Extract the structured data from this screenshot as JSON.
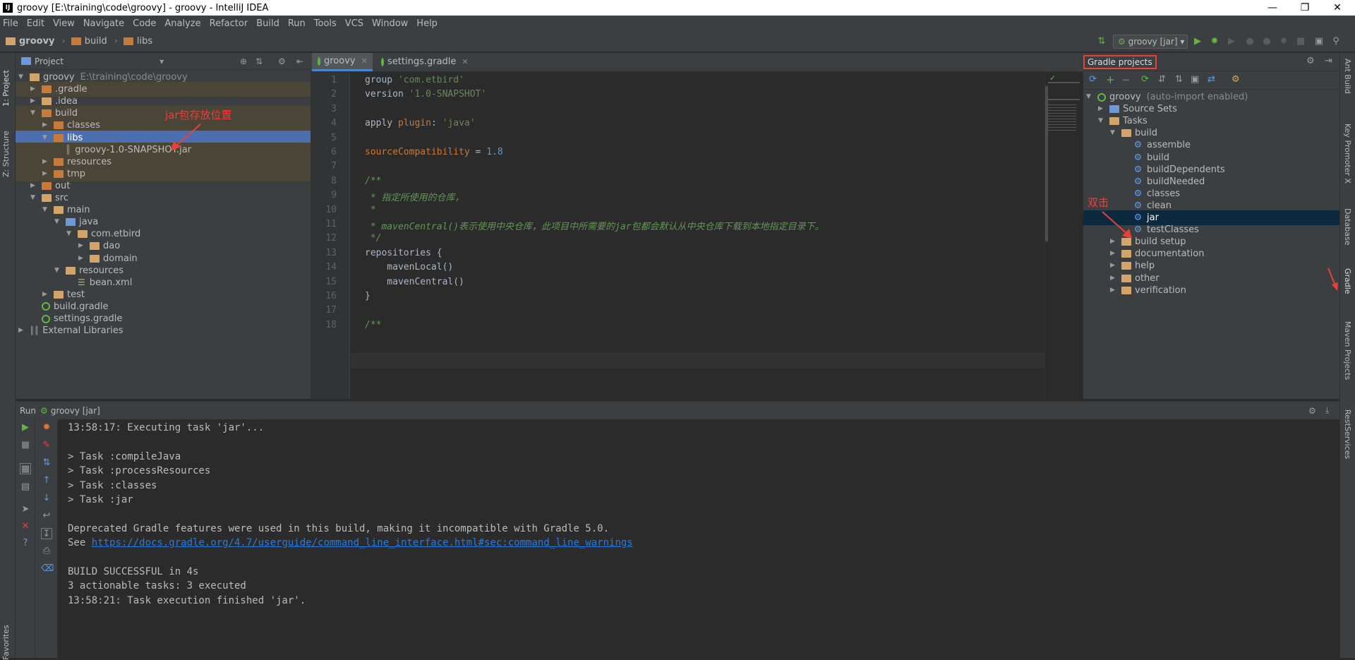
{
  "window": {
    "title": "groovy [E:\\training\\code\\groovy] - groovy - IntelliJ IDEA",
    "app_icon": "IJ"
  },
  "menu": [
    "File",
    "Edit",
    "View",
    "Navigate",
    "Code",
    "Analyze",
    "Refactor",
    "Build",
    "Run",
    "Tools",
    "VCS",
    "Window",
    "Help"
  ],
  "breadcrumb": [
    "groovy",
    "build",
    "libs"
  ],
  "run_config": "groovy [jar]",
  "left_tabs": [
    "1: Project",
    "Z: Structure",
    "Favorites"
  ],
  "project_panel": {
    "title": "Project",
    "tree": [
      {
        "label": "groovy",
        "extra": "E:\\training\\code\\groovy",
        "depth": 0,
        "expanded": true,
        "icon": "folder"
      },
      {
        "label": ".gradle",
        "depth": 1,
        "expanded": false,
        "icon": "folder-orange",
        "excluded": true
      },
      {
        "label": ".idea",
        "depth": 1,
        "expanded": false,
        "icon": "folder"
      },
      {
        "label": "build",
        "depth": 1,
        "expanded": true,
        "icon": "folder-orange",
        "excluded": true
      },
      {
        "label": "classes",
        "depth": 2,
        "expanded": false,
        "icon": "folder-orange",
        "excluded": true
      },
      {
        "label": "libs",
        "depth": 2,
        "expanded": true,
        "icon": "folder-orange",
        "selected": true
      },
      {
        "label": "groovy-1.0-SNAPSHOT.jar",
        "depth": 3,
        "leaf": true,
        "icon": "jar",
        "excluded": true
      },
      {
        "label": "resources",
        "depth": 2,
        "expanded": false,
        "icon": "folder-orange",
        "excluded": true
      },
      {
        "label": "tmp",
        "depth": 2,
        "expanded": false,
        "icon": "folder-orange",
        "excluded": true
      },
      {
        "label": "out",
        "depth": 1,
        "expanded": false,
        "icon": "folder-orange"
      },
      {
        "label": "src",
        "depth": 1,
        "expanded": true,
        "icon": "folder"
      },
      {
        "label": "main",
        "depth": 2,
        "expanded": true,
        "icon": "folder"
      },
      {
        "label": "java",
        "depth": 3,
        "expanded": true,
        "icon": "folder-blue"
      },
      {
        "label": "com.etbird",
        "depth": 4,
        "expanded": true,
        "icon": "folder"
      },
      {
        "label": "dao",
        "depth": 5,
        "expanded": false,
        "icon": "folder"
      },
      {
        "label": "domain",
        "depth": 5,
        "expanded": false,
        "icon": "folder"
      },
      {
        "label": "resources",
        "depth": 3,
        "expanded": true,
        "icon": "folder"
      },
      {
        "label": "bean.xml",
        "depth": 4,
        "leaf": true,
        "icon": "xml"
      },
      {
        "label": "test",
        "depth": 2,
        "expanded": false,
        "icon": "folder"
      },
      {
        "label": "build.gradle",
        "depth": 1,
        "leaf": true,
        "icon": "gradle"
      },
      {
        "label": "settings.gradle",
        "depth": 1,
        "leaf": true,
        "icon": "gradle"
      },
      {
        "label": "External Libraries",
        "depth": 0,
        "expanded": false,
        "icon": "lib"
      }
    ],
    "annotation": "jar包存放位置"
  },
  "editor": {
    "tabs": [
      {
        "label": "groovy",
        "active": true
      },
      {
        "label": "settings.gradle",
        "active": false
      }
    ],
    "line_numbers": [
      "1",
      "2",
      "3",
      "4",
      "5",
      "6",
      "7",
      "8",
      "9",
      "10",
      "11",
      "12",
      "13",
      "14",
      "15",
      "16",
      "17",
      "18"
    ],
    "lines": [
      [
        {
          "t": "group ",
          "c": "plain"
        },
        {
          "t": "'com.etbird'",
          "c": "str"
        }
      ],
      [
        {
          "t": "version ",
          "c": "plain"
        },
        {
          "t": "'1.0-SNAPSHOT'",
          "c": "str"
        }
      ],
      [],
      [
        {
          "t": "apply ",
          "c": "plain"
        },
        {
          "t": "plugin",
          "c": "kw"
        },
        {
          "t": ": ",
          "c": "plain"
        },
        {
          "t": "'java'",
          "c": "str"
        }
      ],
      [],
      [
        {
          "t": "sourceCompatibility",
          "c": "kw"
        },
        {
          "t": " = ",
          "c": "plain"
        },
        {
          "t": "1.8",
          "c": "num"
        }
      ],
      [],
      [
        {
          "t": "/**",
          "c": "cmt"
        }
      ],
      [
        {
          "t": " * 指定所使用的仓库，",
          "c": "cmt"
        }
      ],
      [
        {
          "t": " *",
          "c": "cmt"
        }
      ],
      [
        {
          "t": " * mavenCentral()表示使用中央仓库，此项目中所需要的jar包都会默认从中央仓库下载到本地指定目录下。",
          "c": "cmt"
        }
      ],
      [
        {
          "t": " */",
          "c": "cmt"
        }
      ],
      [
        {
          "t": "repositories {",
          "c": "plain"
        }
      ],
      [
        {
          "t": "    mavenLocal()",
          "c": "plain"
        }
      ],
      [
        {
          "t": "    mavenCentral()",
          "c": "plain"
        }
      ],
      [
        {
          "t": "}",
          "c": "plain"
        }
      ],
      [],
      [
        {
          "t": "/**",
          "c": "cmt"
        }
      ]
    ]
  },
  "gradle_panel": {
    "title": "Gradle projects",
    "tree": [
      {
        "label": "groovy",
        "extra": "(auto-import enabled)",
        "depth": 0,
        "expanded": true,
        "icon": "gradle"
      },
      {
        "label": "Source Sets",
        "depth": 1,
        "expanded": false,
        "icon": "sets"
      },
      {
        "label": "Tasks",
        "depth": 1,
        "expanded": true,
        "icon": "folder"
      },
      {
        "label": "build",
        "depth": 2,
        "expanded": true,
        "icon": "folder"
      },
      {
        "label": "assemble",
        "depth": 3,
        "leaf": true,
        "icon": "gear"
      },
      {
        "label": "build",
        "depth": 3,
        "leaf": true,
        "icon": "gear"
      },
      {
        "label": "buildDependents",
        "depth": 3,
        "leaf": true,
        "icon": "gear"
      },
      {
        "label": "buildNeeded",
        "depth": 3,
        "leaf": true,
        "icon": "gear"
      },
      {
        "label": "classes",
        "depth": 3,
        "leaf": true,
        "icon": "gear"
      },
      {
        "label": "clean",
        "depth": 3,
        "leaf": true,
        "icon": "gear"
      },
      {
        "label": "jar",
        "depth": 3,
        "leaf": true,
        "icon": "gear",
        "selected": true
      },
      {
        "label": "testClasses",
        "depth": 3,
        "leaf": true,
        "icon": "gear"
      },
      {
        "label": "build setup",
        "depth": 2,
        "expanded": false,
        "icon": "folder"
      },
      {
        "label": "documentation",
        "depth": 2,
        "expanded": false,
        "icon": "folder"
      },
      {
        "label": "help",
        "depth": 2,
        "expanded": false,
        "icon": "folder"
      },
      {
        "label": "other",
        "depth": 2,
        "expanded": false,
        "icon": "folder"
      },
      {
        "label": "verification",
        "depth": 2,
        "expanded": false,
        "icon": "folder"
      }
    ],
    "annotation": "双击"
  },
  "right_tabs": [
    "Ant Build",
    "Key Promoter X",
    "Database",
    "Gradle",
    "Maven Projects",
    "RestServices"
  ],
  "run_panel": {
    "label": "Run",
    "config": "groovy [jar]",
    "lines": [
      [
        {
          "t": "13:58:17: Executing task 'jar'...",
          "c": ""
        }
      ],
      [],
      [
        {
          "t": "> Task :compileJava",
          "c": ""
        }
      ],
      [
        {
          "t": "> Task :processResources",
          "c": ""
        }
      ],
      [
        {
          "t": "> Task :classes",
          "c": ""
        }
      ],
      [
        {
          "t": "> Task :jar",
          "c": ""
        }
      ],
      [],
      [
        {
          "t": "Deprecated Gradle features were used in this build, making it incompatible with Gradle 5.0.",
          "c": ""
        }
      ],
      [
        {
          "t": "See ",
          "c": ""
        },
        {
          "t": "https://docs.gradle.org/4.7/userguide/command_line_interface.html#sec:command_line_warnings",
          "c": "link"
        }
      ],
      [],
      [
        {
          "t": "BUILD SUCCESSFUL in 4s",
          "c": ""
        }
      ],
      [
        {
          "t": "3 actionable tasks: 3 executed",
          "c": ""
        }
      ],
      [
        {
          "t": "13:58:21: Task execution finished 'jar'.",
          "c": ""
        }
      ]
    ]
  }
}
